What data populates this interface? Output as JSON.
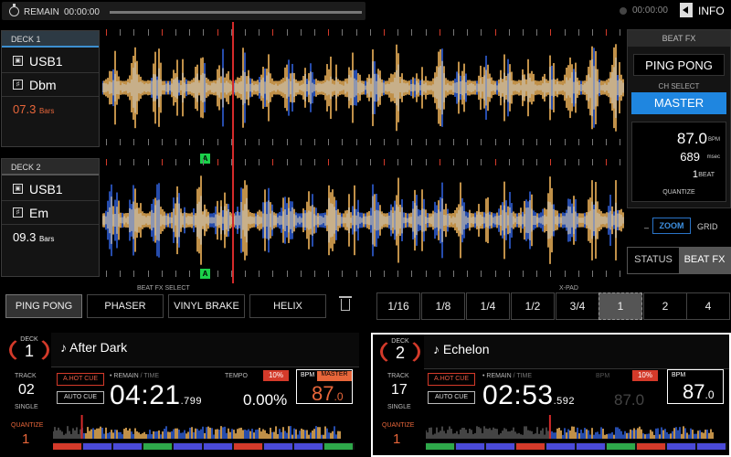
{
  "topbar": {
    "remain_label": "REMAIN",
    "remain_time": "00:00:00",
    "right_time": "00:00:00",
    "info_label": "INFO"
  },
  "deck_panels": [
    {
      "header": "DECK 1",
      "source": "USB1",
      "key": "Dbm",
      "bars_value": "07.3",
      "bars_unit": "Bars",
      "bars_color": "#e8663a"
    },
    {
      "header": "DECK 2",
      "source": "USB1",
      "key": "Em",
      "bars_value": "09.3",
      "bars_unit": "Bars",
      "bars_color": "#ffffff"
    }
  ],
  "waveform": {
    "cue_marker_label": "A"
  },
  "beat_fx": {
    "header": "BEAT FX",
    "effect": "PING PONG",
    "ch_select_label": "CH SELECT",
    "channel": "MASTER",
    "bpm": "87.0",
    "bpm_unit": "BPM",
    "msec": "689",
    "msec_unit": "msec",
    "beat": "1",
    "beat_unit": "BEAT",
    "quantize": "QUANTIZE",
    "zoom_dash": "–",
    "zoom": "ZOOM",
    "grid": "GRID",
    "status_tab": "STATUS",
    "beatfx_tab": "BEAT FX"
  },
  "fx_select": {
    "label": "BEAT FX SELECT",
    "effects": [
      "PING PONG",
      "PHASER",
      "VINYL BRAKE",
      "HELIX"
    ],
    "selected": 0
  },
  "xpad": {
    "label": "X-PAD",
    "values": [
      "1/16",
      "1/8",
      "1/4",
      "1/2",
      "3/4",
      "1",
      "2",
      "4"
    ],
    "selected": 5
  },
  "decks": [
    {
      "deck_label": "DECK",
      "deck_number": "1",
      "title": "After Dark",
      "track_label": "TRACK",
      "track": "02",
      "mode": "SINGLE",
      "quantize_label": "QUANTIZE",
      "quantize": "1",
      "hotcue": "A.HOT CUE",
      "autocue": "AUTO CUE",
      "remain_label": "• REMAIN",
      "time_label": "/ TIME",
      "time_main": "04:21",
      "time_frac": ".799",
      "tempo_label": "TEMPO",
      "tempo_range": "10%",
      "tempo": "0.00%",
      "bpm_label": "BPM",
      "bpm_master": "MASTER",
      "bpm_int": "87",
      "bpm_frac": ".0",
      "bpm_color": "#e8663a",
      "playback_position": 0.1
    },
    {
      "deck_label": "DECK",
      "deck_number": "2",
      "title": "Echelon",
      "track_label": "TRACK",
      "track": "17",
      "mode": "SINGLE",
      "quantize_label": "QUANTIZE",
      "quantize": "1",
      "hotcue": "A.HOT CUE",
      "autocue": "AUTO CUE",
      "remain_label": "• REMAIN",
      "time_label": "/ TIME",
      "time_main": "02:53",
      "time_frac": ".592",
      "tempo_label": "BPM",
      "tempo_range": "10%",
      "tempo": "87.0",
      "bpm_label": "BPM",
      "bpm_int": "87",
      "bpm_frac": ".0",
      "bpm_color": "#ffffff",
      "playback_position": 0.43
    }
  ],
  "icons": {
    "clock": "clock-icon",
    "info": "triangle-left-icon",
    "usb": "usb-icon",
    "key": "key-icon",
    "note": "music-note-icon",
    "trash": "trash-icon"
  },
  "colors": {
    "accent_blue": "#1f86e0",
    "accent_red": "#d43a2a",
    "accent_orange": "#e8663a",
    "wave_gold": "#f0b45a",
    "wave_blue": "#2f5fd8"
  }
}
